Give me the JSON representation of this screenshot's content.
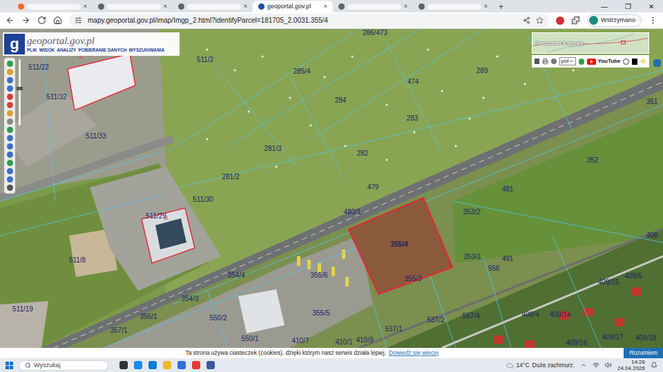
{
  "browser": {
    "tabs": [
      {
        "blurred": true,
        "selected": false,
        "color": "#f26a21"
      },
      {
        "blurred": true,
        "selected": false,
        "color": "#5f6368"
      },
      {
        "blurred": true,
        "selected": false,
        "color": "#5f6368"
      },
      {
        "label": "geoportal.gov.pl",
        "blurred": false,
        "selected": true,
        "color": "#1f4e9c"
      },
      {
        "blurred": true,
        "selected": false,
        "color": "#5f6368"
      },
      {
        "blurred": true,
        "selected": false,
        "color": "#5f6368"
      }
    ],
    "tab_close": "×",
    "new_tab": "+",
    "window_controls": [
      "—",
      "❐",
      "✕"
    ],
    "address": "mapy.geoportal.gov.pl/imap/Imgp_2.html?identifyParcel=181705_2.0031.355/4",
    "profile_label": "Wstrzymano"
  },
  "geoportal": {
    "logo_mark": "g",
    "logo_name": "geoportal.gov.pl",
    "menu": [
      "PLIK",
      "WIDOK",
      "ANALIZY",
      "POBIERANIE DANYCH",
      "WYSZUKIWANIA"
    ],
    "minimap_title": "Geoportal krajowy",
    "language": "pol",
    "youtube": "YouTube",
    "buildings": [
      {
        "label": "b"
      },
      {
        "label": "b"
      }
    ],
    "parcels": [
      {
        "label": "286/473",
        "selected": false
      },
      {
        "label": "511/22",
        "selected": false
      },
      {
        "label": "511/2",
        "selected": false
      },
      {
        "label": "285/4",
        "selected": false
      },
      {
        "label": "289",
        "selected": false
      },
      {
        "label": "474",
        "selected": false
      },
      {
        "label": "511/32",
        "selected": false
      },
      {
        "label": "284",
        "selected": false
      },
      {
        "label": "351",
        "selected": false
      },
      {
        "label": "283",
        "selected": false
      },
      {
        "label": "511/33",
        "selected": false
      },
      {
        "label": "281/3",
        "selected": false
      },
      {
        "label": "282",
        "selected": false
      },
      {
        "label": "352",
        "selected": false
      },
      {
        "label": "281/2",
        "selected": false
      },
      {
        "label": "479",
        "selected": false
      },
      {
        "label": "481",
        "selected": false
      },
      {
        "label": "511/30",
        "selected": false
      },
      {
        "label": "480/1",
        "selected": false
      },
      {
        "label": "353/2",
        "selected": false
      },
      {
        "label": "511/29",
        "selected": false
      },
      {
        "label": "408",
        "selected": false
      },
      {
        "label": "355/4",
        "selected": true
      },
      {
        "label": "353/1",
        "selected": false
      },
      {
        "label": "491",
        "selected": false
      },
      {
        "label": "511/8",
        "selected": false
      },
      {
        "label": "556",
        "selected": false
      },
      {
        "label": "354/4",
        "selected": false
      },
      {
        "label": "355/6",
        "selected": false
      },
      {
        "label": "409/5",
        "selected": false
      },
      {
        "label": "355/3",
        "selected": false
      },
      {
        "label": "409/15",
        "selected": false
      },
      {
        "label": "354/3",
        "selected": false
      },
      {
        "label": "511/19",
        "selected": false
      },
      {
        "label": "409/4",
        "selected": false
      },
      {
        "label": "409/14",
        "selected": false
      },
      {
        "label": "557/4",
        "selected": false
      },
      {
        "label": "356/1",
        "selected": false
      },
      {
        "label": "550/2",
        "selected": false
      },
      {
        "label": "355/5",
        "selected": false
      },
      {
        "label": "537/2",
        "selected": false
      },
      {
        "label": "357/1",
        "selected": false
      },
      {
        "label": "537/1",
        "selected": false
      },
      {
        "label": "409/17",
        "selected": false
      },
      {
        "label": "409/18",
        "selected": false
      },
      {
        "label": "550/1",
        "selected": false
      },
      {
        "label": "410/7",
        "selected": false
      },
      {
        "label": "410/1",
        "selected": false
      },
      {
        "label": "410/9",
        "selected": false
      },
      {
        "label": "409/16",
        "selected": false
      }
    ]
  },
  "cookie_bar": {
    "text": "Ta strona używa ciasteczek (cookies), dzięki którym nasz serwis działa lepiej.",
    "link": "Dowiedz się więcej",
    "button": "Rozumiem"
  },
  "taskbar": {
    "search_placeholder": "Wyszukaj",
    "temperature": "14°C",
    "weather": "Duże zachmurz.",
    "time": "14:26",
    "date": "24.04.2026"
  }
}
